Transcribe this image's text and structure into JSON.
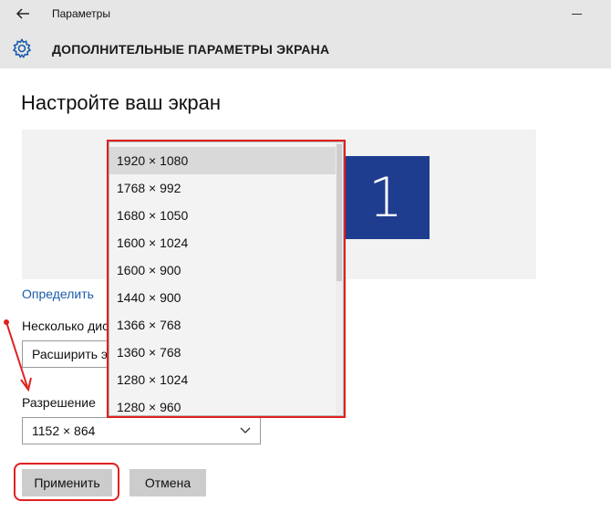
{
  "window": {
    "title": "Параметры"
  },
  "header": {
    "title": "ДОПОЛНИТЕЛЬНЫЕ ПАРАМЕТРЫ ЭКРАНА"
  },
  "page": {
    "heading": "Настройте ваш экран",
    "display_number": "1",
    "identify_link": "Определить",
    "multi_display_label": "Несколько дис",
    "multi_display_value": "Расширить э",
    "resolution_label": "Разрешение",
    "resolution_value": "1152 × 864"
  },
  "buttons": {
    "apply": "Применить",
    "cancel": "Отмена"
  },
  "dropdown": {
    "options": [
      "1920 × 1080",
      "1768 × 992",
      "1680 × 1050",
      "1600 × 1024",
      "1600 × 900",
      "1440 × 900",
      "1366 × 768",
      "1360 × 768",
      "1280 × 1024",
      "1280 × 960"
    ],
    "highlighted": "1920 × 1080"
  },
  "colors": {
    "accent_link": "#1b5bab",
    "monitor": "#1f3d8f",
    "annotation": "#e02020"
  },
  "icons": {
    "back": "back-arrow-icon",
    "settings": "gear-icon",
    "chevron": "chevron-down-icon"
  }
}
